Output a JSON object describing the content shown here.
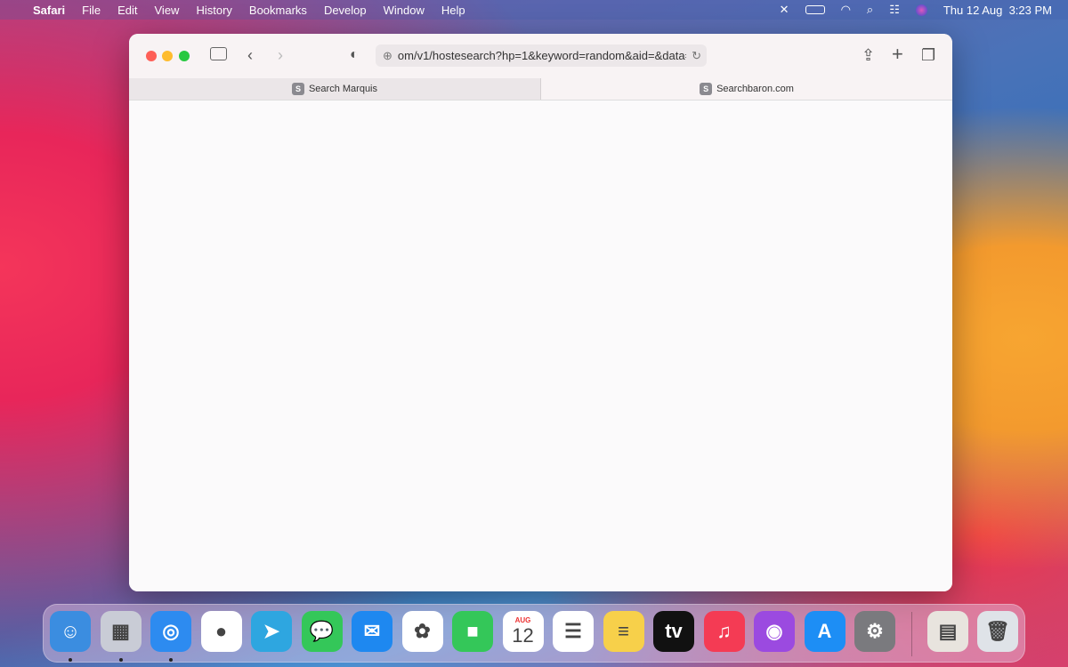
{
  "menubar": {
    "app": "Safari",
    "items": [
      "File",
      "Edit",
      "View",
      "History",
      "Bookmarks",
      "Develop",
      "Window",
      "Help"
    ],
    "clock": "Thu 12 Aug  3:23 PM"
  },
  "browser": {
    "url": "om/v1/hostesearch?hp=1&keyword=random&aid=&data=",
    "tabs": [
      {
        "label": "Search Marquis",
        "favicon": "S",
        "active": false
      },
      {
        "label": "Searchbaron.com",
        "favicon": "S",
        "active": true
      }
    ]
  },
  "dock": {
    "apps": [
      {
        "name": "Finder",
        "color": "#3b8de0",
        "glyph": "☺",
        "running": true
      },
      {
        "name": "Launchpad",
        "color": "#c9ccd6",
        "glyph": "▦",
        "running": true
      },
      {
        "name": "Safari",
        "color": "#2d8bf0",
        "glyph": "◎",
        "running": true
      },
      {
        "name": "Chrome",
        "color": "#ffffff",
        "glyph": "●",
        "running": false
      },
      {
        "name": "Telegram",
        "color": "#2ea6e0",
        "glyph": "➤",
        "running": false
      },
      {
        "name": "Messages",
        "color": "#34c759",
        "glyph": "💬",
        "running": false
      },
      {
        "name": "Mail",
        "color": "#1e88f0",
        "glyph": "✉",
        "running": false
      },
      {
        "name": "Photos",
        "color": "#ffffff",
        "glyph": "✿",
        "running": false
      },
      {
        "name": "FaceTime",
        "color": "#34c759",
        "glyph": "■",
        "running": false
      },
      {
        "name": "Calendar",
        "color": "#ffffff",
        "glyph": "12",
        "running": false
      },
      {
        "name": "Reminders",
        "color": "#ffffff",
        "glyph": "☰",
        "running": false
      },
      {
        "name": "Notes",
        "color": "#f7d04a",
        "glyph": "≡",
        "running": false
      },
      {
        "name": "TV",
        "color": "#111111",
        "glyph": "tv",
        "running": false
      },
      {
        "name": "Music",
        "color": "#f43b54",
        "glyph": "♫",
        "running": false
      },
      {
        "name": "Podcasts",
        "color": "#9b4ae0",
        "glyph": "◉",
        "running": false
      },
      {
        "name": "App Store",
        "color": "#1d8ef5",
        "glyph": "A",
        "running": false
      },
      {
        "name": "System Preferences",
        "color": "#7a7a7e",
        "glyph": "⚙",
        "running": false
      },
      {
        "name": "Archive",
        "color": "#e8e4de",
        "glyph": "▤",
        "running": false
      },
      {
        "name": "Trash",
        "color": "#dfe3e8",
        "glyph": "🗑",
        "running": false
      }
    ],
    "calendar_month": "AUG"
  }
}
